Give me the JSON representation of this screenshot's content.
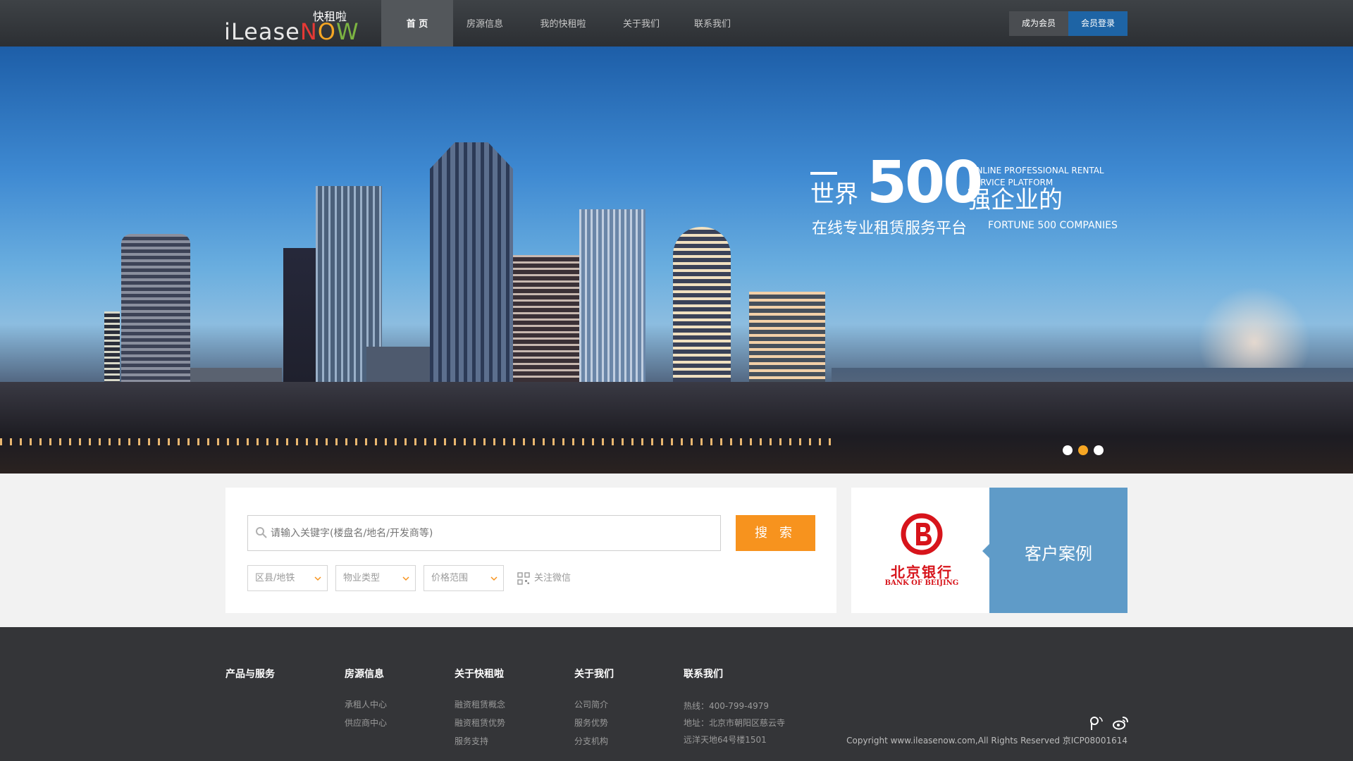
{
  "header": {
    "logo_cn": "快租啦",
    "logo_en_main": "iLease",
    "logo_en_n": "N",
    "logo_en_o": "O",
    "logo_en_w": "W",
    "nav": [
      {
        "label": "首 页",
        "active": true
      },
      {
        "label": "房源信息"
      },
      {
        "label": "我的快租啦"
      },
      {
        "label": "关于我们"
      },
      {
        "label": "联系我们"
      }
    ],
    "member_label": "成为会员",
    "login_label": "会员登录"
  },
  "banner": {
    "world": "世界",
    "number": "500",
    "en_line1": "ONLINE PROFESSIONAL RENTAL SERVICE PLATFORM",
    "strong": "强企业的",
    "subtitle": "在线专业租赁服务平台",
    "en_line2": "FORTUNE 500 COMPANIES",
    "active_slide": 2,
    "slide_count": 3
  },
  "search": {
    "placeholder": "请输入关键字(楼盘名/地名/开发商等)",
    "button_label": "搜 索",
    "filters": [
      "区县/地铁",
      "物业类型",
      "价格范围"
    ],
    "wechat_label": "关注微信"
  },
  "case": {
    "bank_cn": "北京银行",
    "bank_en": "BANK OF BEIJING",
    "title": "客户案例"
  },
  "footer": {
    "columns": [
      {
        "title": "产品与服务",
        "links": []
      },
      {
        "title": "房源信息",
        "links": [
          "承租人中心",
          "供应商中心"
        ]
      },
      {
        "title": "关于快租啦",
        "links": [
          "融资租赁概念",
          "融资租赁优势",
          "服务支持"
        ]
      },
      {
        "title": "关于我们",
        "links": [
          "公司简介",
          "服务优势",
          "分支机构"
        ]
      }
    ],
    "contact_title": "联系我们",
    "contact_lines": [
      "热线：400-799-4979",
      "地址：北京市朝阳区慈云寺",
      "远洋天地64号楼1501"
    ],
    "copyright": "Copyright www.ileasenow.com,All Rights Reserved 京ICP08001614"
  },
  "colors": {
    "header_bg": "#2f3236",
    "accent_orange": "#f7931e",
    "login_blue": "#1e64a5",
    "case_blue": "#5f9bc8",
    "footer_bg": "#343538",
    "bank_red": "#d7141b"
  }
}
